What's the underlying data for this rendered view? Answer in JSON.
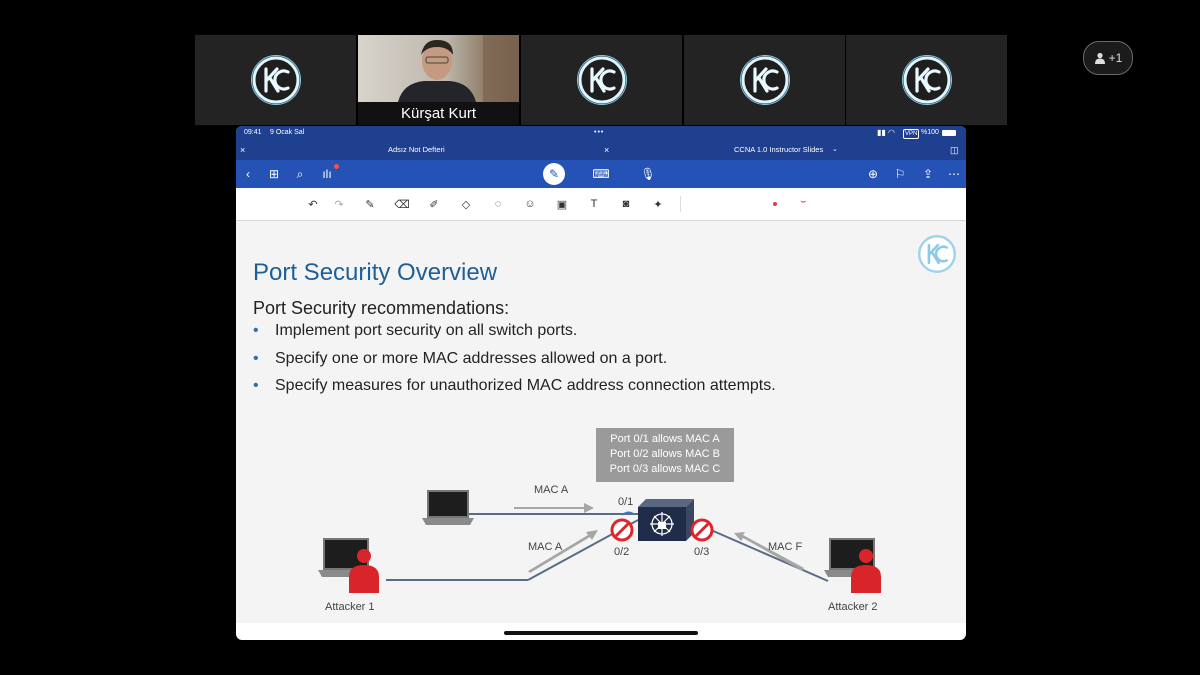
{
  "participants": [
    {
      "type": "logo"
    },
    {
      "type": "camera",
      "name": "Kürşat Kurt"
    },
    {
      "type": "logo"
    },
    {
      "type": "logo"
    },
    {
      "type": "logo"
    }
  ],
  "participant_count": "+1",
  "ipad": {
    "status_time": "09:41",
    "status_date": "9 Ocak Sal",
    "battery": "%100",
    "vpn": "VPN",
    "tab_left": "Adsız Not Defteri",
    "tab_right": "CCNA 1.0 Instructor Slides"
  },
  "slide": {
    "title": "Port Security Overview",
    "subhead": "Port Security recommendations:",
    "bullets": [
      "Implement port security on all switch ports.",
      "Specify one or more MAC addresses allowed on a port.",
      "Specify measures for unauthorized MAC address connection attempts."
    ],
    "rules": [
      "Port 0/1 allows MAC A",
      "Port 0/2 allows MAC B",
      "Port 0/3 allows MAC C"
    ],
    "arrow_top": "MAC A",
    "arrow_left": "MAC A",
    "arrow_right": "MAC F",
    "port1": "0/1",
    "port2": "0/2",
    "port3": "0/3",
    "attacker1": "Attacker 1",
    "attacker2": "Attacker 2"
  },
  "colors": {
    "brand_dark": "#1f3f8f",
    "brand": "#2553b5",
    "title": "#1f5f97",
    "attacker": "#d9252a",
    "block": "#e0242a"
  }
}
